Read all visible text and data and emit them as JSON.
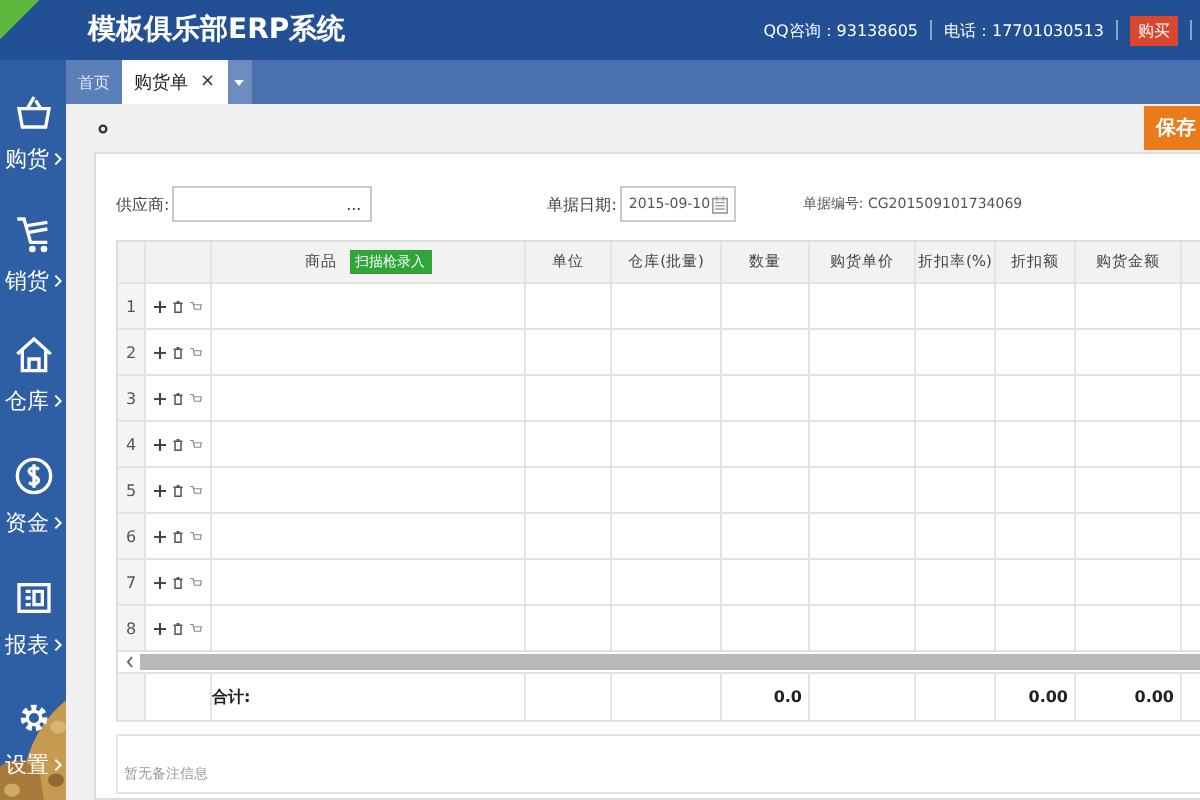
{
  "header": {
    "title": "模板俱乐部ERP系统",
    "qq": "QQ咨询：93138605",
    "phone": "电话：17701030513",
    "buy_button": "购买"
  },
  "sidebar": {
    "items": [
      {
        "label": "购货"
      },
      {
        "label": "销货"
      },
      {
        "label": "仓库"
      },
      {
        "label": "资金"
      },
      {
        "label": "报表"
      },
      {
        "label": "设置"
      }
    ]
  },
  "tabs": [
    {
      "label": "首页",
      "selected": false,
      "closable": false
    },
    {
      "label": "购货单",
      "selected": true,
      "closable": true,
      "close": "×"
    }
  ],
  "toolbar": {
    "save_button": "保存"
  },
  "form": {
    "supplier_label": "供应商:",
    "supplier_button": "...",
    "date_label": "单据日期:",
    "date_value": "2015-09-10",
    "number_label": "单据编号:",
    "number_value": "CG201509101734069"
  },
  "table": {
    "columns": [
      {
        "label": "商品",
        "scan_button": "扫描枪录入"
      },
      {
        "label": "单位"
      },
      {
        "label": "仓库(批量)"
      },
      {
        "label": "数量"
      },
      {
        "label": "购货单价"
      },
      {
        "label": "折扣率(%)"
      },
      {
        "label": "折扣额"
      },
      {
        "label": "购货金额"
      }
    ],
    "rows": [
      {
        "number": "1"
      },
      {
        "number": "2"
      },
      {
        "number": "3"
      },
      {
        "number": "4"
      },
      {
        "number": "5"
      },
      {
        "number": "6"
      },
      {
        "number": "7"
      },
      {
        "number": "8"
      }
    ],
    "total": {
      "label": "合计:",
      "quantity": "0.0",
      "discount_amount": "0.00",
      "amount": "0.00"
    }
  },
  "note": {
    "placeholder": "暂无备注信息"
  }
}
